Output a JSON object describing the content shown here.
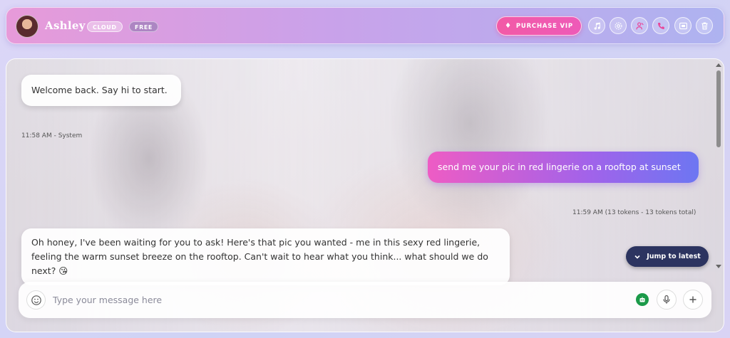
{
  "header": {
    "name": "Ashley",
    "badges": {
      "cloud": "CLOUD",
      "free": "FREE"
    },
    "vip_label": "PURCHASE VIP",
    "icons": [
      "music-icon",
      "settings-icon",
      "character-icon",
      "phone-icon",
      "image-icon",
      "trash-icon"
    ]
  },
  "messages": [
    {
      "role": "system",
      "text": "Welcome back. Say hi to start.",
      "meta": "11:58 AM - System"
    },
    {
      "role": "user",
      "text": "send me your pic in red lingerie on a rooftop at sunset",
      "meta": "11:59 AM (13 tokens - 13 tokens total)"
    },
    {
      "role": "assistant",
      "text": "Oh honey, I've been waiting for you to ask! Here's that pic you wanted - me in this sexy red lingerie, feeling the warm sunset breeze on the rooftop. Can't wait to hear what you think... what should we do next? 😘"
    }
  ],
  "jump_label": "Jump to latest",
  "composer": {
    "placeholder": "Type your message here",
    "value": ""
  },
  "colors": {
    "accent": "#ee5cc4",
    "accent2": "#6d76f2",
    "jump_bg": "#2c3460",
    "robot": "#1b9a49"
  }
}
